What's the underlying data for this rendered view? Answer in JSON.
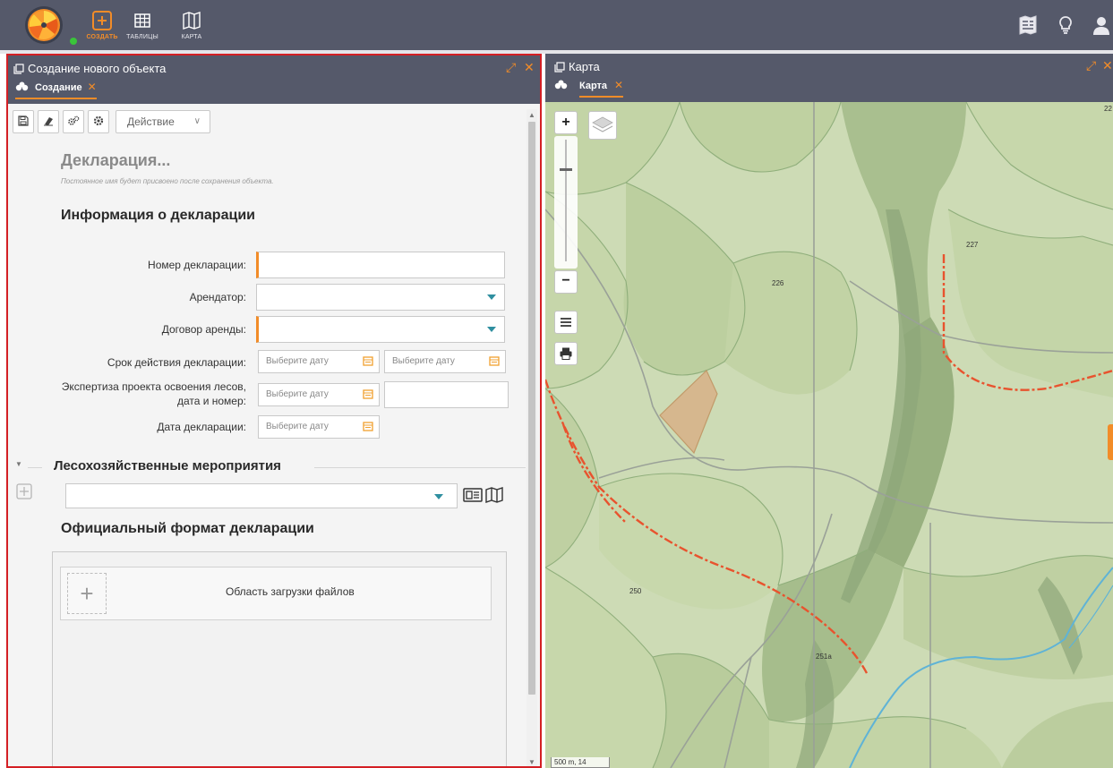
{
  "topbar": {
    "nav": [
      {
        "label": "СОЗДАТЬ",
        "icon": "plus-square-icon",
        "active": true
      },
      {
        "label": "ТАБЛИЦЫ",
        "icon": "table-icon",
        "active": false
      },
      {
        "label": "КАРТА",
        "icon": "map-icon",
        "active": false
      }
    ],
    "right_icons": [
      "map-book-icon",
      "lightbulb-icon",
      "user-icon"
    ],
    "accent": "#f28c28",
    "bar_color": "#55596a"
  },
  "left_panel": {
    "title": "Создание нового объекта",
    "tab": {
      "label": "Создание",
      "close": "✕"
    },
    "controls": {
      "expand": "⤢",
      "close": "✕"
    },
    "toolbar": {
      "buttons": [
        "save-icon",
        "eraser-icon",
        "gears-icon",
        "gear-icon"
      ],
      "action_label": "Действие",
      "action_caret": "∨"
    },
    "object_name": "Декларация...",
    "object_hint": "Постоянное имя будет присвоено после сохранения объекта.",
    "info_section": {
      "title": "Информация о декларации",
      "fields": {
        "number_label": "Номер декларации:",
        "tenant_label": "Арендатор:",
        "contract_label": "Договор аренды:",
        "validity_label": "Срок действия декларации:",
        "expertise_label_1": "Экспертиза проекта освоения лесов,",
        "expertise_label_2": "дата и номер:",
        "date_label": "Дата декларации:",
        "date_placeholder": "Выберите дату"
      }
    },
    "measures_section": {
      "title": "Лесохозяйственные мероприятия",
      "arrow": "▼"
    },
    "format_section": {
      "title": "Официальный формат декларации",
      "upload_plus": "+",
      "upload_label": "Область загрузки файлов"
    }
  },
  "map_panel": {
    "title": "Карта",
    "tab": {
      "label": "Карта",
      "close": "✕"
    },
    "controls": {
      "expand": "⤢",
      "close": "✕"
    },
    "zoom_in": "+",
    "zoom_out": "−",
    "scale": "500 m, 14",
    "labels": [
      "227",
      "226",
      "250",
      "251а",
      "22"
    ],
    "colors": {
      "base": "#cddbb5",
      "forest": "#aec395",
      "road": "#e8532e",
      "river": "#5fb3d6",
      "parcel": "#d7b48a"
    }
  }
}
